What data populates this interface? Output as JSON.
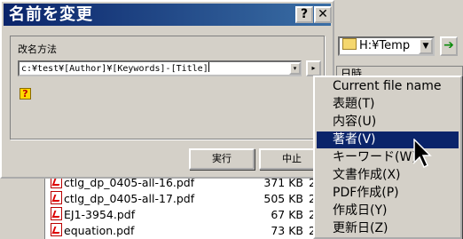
{
  "background_window": {
    "path_combo": "H:¥Temp",
    "column_header": "日時",
    "files": [
      {
        "name": "ctlg_dp_0405-all-16.pdf",
        "size": "371 KB",
        "extra": "2"
      },
      {
        "name": "ctlg_dp_0405-all-17.pdf",
        "size": "505 KB",
        "extra": "2"
      },
      {
        "name": "EJ1-3954.pdf",
        "size": "67 KB",
        "extra": "2"
      },
      {
        "name": "equation.pdf",
        "size": "73 KB",
        "extra": "2"
      }
    ]
  },
  "dialog": {
    "title": "名前を変更",
    "help_button": "?",
    "close_button": "✕",
    "group_label": "改名方法",
    "pattern_value": "c:¥test¥[Author]¥[Keywords]-[Title]",
    "dropdown_glyph": "▾",
    "arrow_glyph": "▸",
    "help_icon_glyph": "?",
    "run_button": "実行",
    "cancel_button": "中止"
  },
  "menu": {
    "items": [
      {
        "label": "Current file name",
        "selected": false
      },
      {
        "label": "表題(T)",
        "selected": false
      },
      {
        "label": "内容(U)",
        "selected": false
      },
      {
        "label": "著者(V)",
        "selected": true
      },
      {
        "label": "キーワード(W)",
        "selected": false
      },
      {
        "label": "文書作成(X)",
        "selected": false
      },
      {
        "label": "PDF作成(P)",
        "selected": false
      },
      {
        "label": "作成日(Y)",
        "selected": false
      },
      {
        "label": "更新日(Z)",
        "selected": false
      }
    ]
  },
  "colors": {
    "titlebar": "#0a246a",
    "selection": "#0a246a",
    "face": "#d4d0c8"
  }
}
